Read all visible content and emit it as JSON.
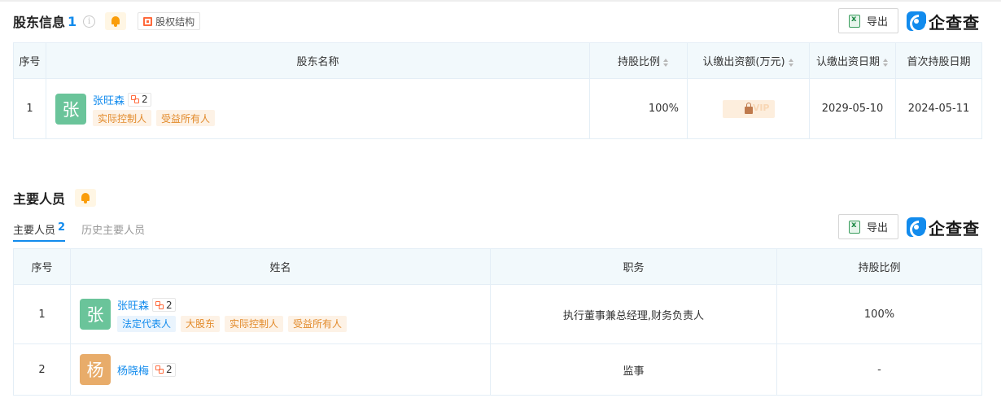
{
  "shareholders": {
    "title": "股东信息",
    "count": "1",
    "info_icon": "i",
    "structure_label": "股权结构",
    "export_label": "导出",
    "brand": "企查查",
    "columns": {
      "index": "序号",
      "name": "股东名称",
      "ratio": "持股比例",
      "amount": "认缴出资额(万元)",
      "date": "认缴出资日期",
      "first_date": "首次持股日期"
    },
    "rows": [
      {
        "index": "1",
        "avatar": "张",
        "avatar_color": "#6ac49a",
        "name": "张旺森",
        "relation_count": "2",
        "tags": [
          "实际控制人",
          "受益所有人"
        ],
        "ratio": "100%",
        "amount_vip": "VIP",
        "date": "2029-05-10",
        "first_date": "2024-05-11"
      }
    ]
  },
  "personnel": {
    "title": "主要人员",
    "tabs": [
      {
        "label": "主要人员",
        "count": "2"
      },
      {
        "label": "历史主要人员"
      }
    ],
    "export_label": "导出",
    "brand": "企查查",
    "columns": {
      "index": "序号",
      "name": "姓名",
      "position": "职务",
      "ratio": "持股比例"
    },
    "rows": [
      {
        "index": "1",
        "avatar": "张",
        "avatar_color": "#6ac49a",
        "name": "张旺森",
        "relation_count": "2",
        "tags": [
          {
            "label": "法定代表人",
            "style": "blue"
          },
          {
            "label": "大股东",
            "style": "orange"
          },
          {
            "label": "实际控制人",
            "style": "orange"
          },
          {
            "label": "受益所有人",
            "style": "orange"
          }
        ],
        "position": "执行董事兼总经理,财务负责人",
        "ratio": "100%"
      },
      {
        "index": "2",
        "avatar": "杨",
        "avatar_color": "#e8ac6a",
        "name": "杨晓梅",
        "relation_count": "2",
        "tags": [],
        "position": "监事",
        "ratio": "-"
      }
    ]
  }
}
